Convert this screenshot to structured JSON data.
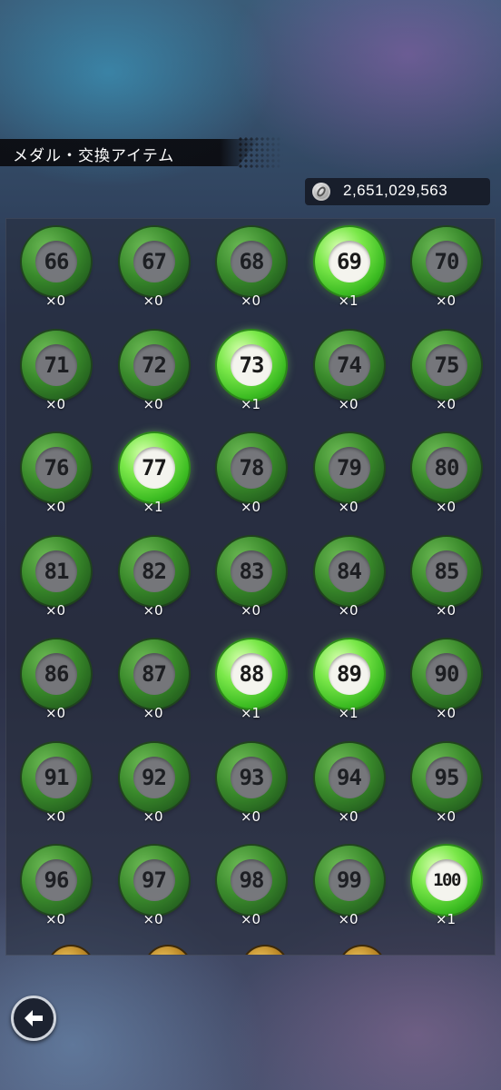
{
  "header": {
    "title": "メダル・交換アイテム"
  },
  "currency": {
    "icon": "coin-icon",
    "value": "2,651,029,563"
  },
  "medals": [
    {
      "number": "66",
      "count": "×0",
      "owned": false
    },
    {
      "number": "67",
      "count": "×0",
      "owned": false
    },
    {
      "number": "68",
      "count": "×0",
      "owned": false
    },
    {
      "number": "69",
      "count": "×1",
      "owned": true
    },
    {
      "number": "70",
      "count": "×0",
      "owned": false
    },
    {
      "number": "71",
      "count": "×0",
      "owned": false
    },
    {
      "number": "72",
      "count": "×0",
      "owned": false
    },
    {
      "number": "73",
      "count": "×1",
      "owned": true
    },
    {
      "number": "74",
      "count": "×0",
      "owned": false
    },
    {
      "number": "75",
      "count": "×0",
      "owned": false
    },
    {
      "number": "76",
      "count": "×0",
      "owned": false
    },
    {
      "number": "77",
      "count": "×1",
      "owned": true
    },
    {
      "number": "78",
      "count": "×0",
      "owned": false
    },
    {
      "number": "79",
      "count": "×0",
      "owned": false
    },
    {
      "number": "80",
      "count": "×0",
      "owned": false
    },
    {
      "number": "81",
      "count": "×0",
      "owned": false
    },
    {
      "number": "82",
      "count": "×0",
      "owned": false
    },
    {
      "number": "83",
      "count": "×0",
      "owned": false
    },
    {
      "number": "84",
      "count": "×0",
      "owned": false
    },
    {
      "number": "85",
      "count": "×0",
      "owned": false
    },
    {
      "number": "86",
      "count": "×0",
      "owned": false
    },
    {
      "number": "87",
      "count": "×0",
      "owned": false
    },
    {
      "number": "88",
      "count": "×1",
      "owned": true
    },
    {
      "number": "89",
      "count": "×1",
      "owned": true
    },
    {
      "number": "90",
      "count": "×0",
      "owned": false
    },
    {
      "number": "91",
      "count": "×0",
      "owned": false
    },
    {
      "number": "92",
      "count": "×0",
      "owned": false
    },
    {
      "number": "93",
      "count": "×0",
      "owned": false
    },
    {
      "number": "94",
      "count": "×0",
      "owned": false
    },
    {
      "number": "95",
      "count": "×0",
      "owned": false
    },
    {
      "number": "96",
      "count": "×0",
      "owned": false
    },
    {
      "number": "97",
      "count": "×0",
      "owned": false
    },
    {
      "number": "98",
      "count": "×0",
      "owned": false
    },
    {
      "number": "99",
      "count": "×0",
      "owned": false
    },
    {
      "number": "100",
      "count": "×1",
      "owned": true
    }
  ],
  "colors": {
    "medal_green": "#3fa425",
    "medal_glow": "#7be84a"
  },
  "footer": {
    "back_icon": "arrow-left-icon"
  }
}
